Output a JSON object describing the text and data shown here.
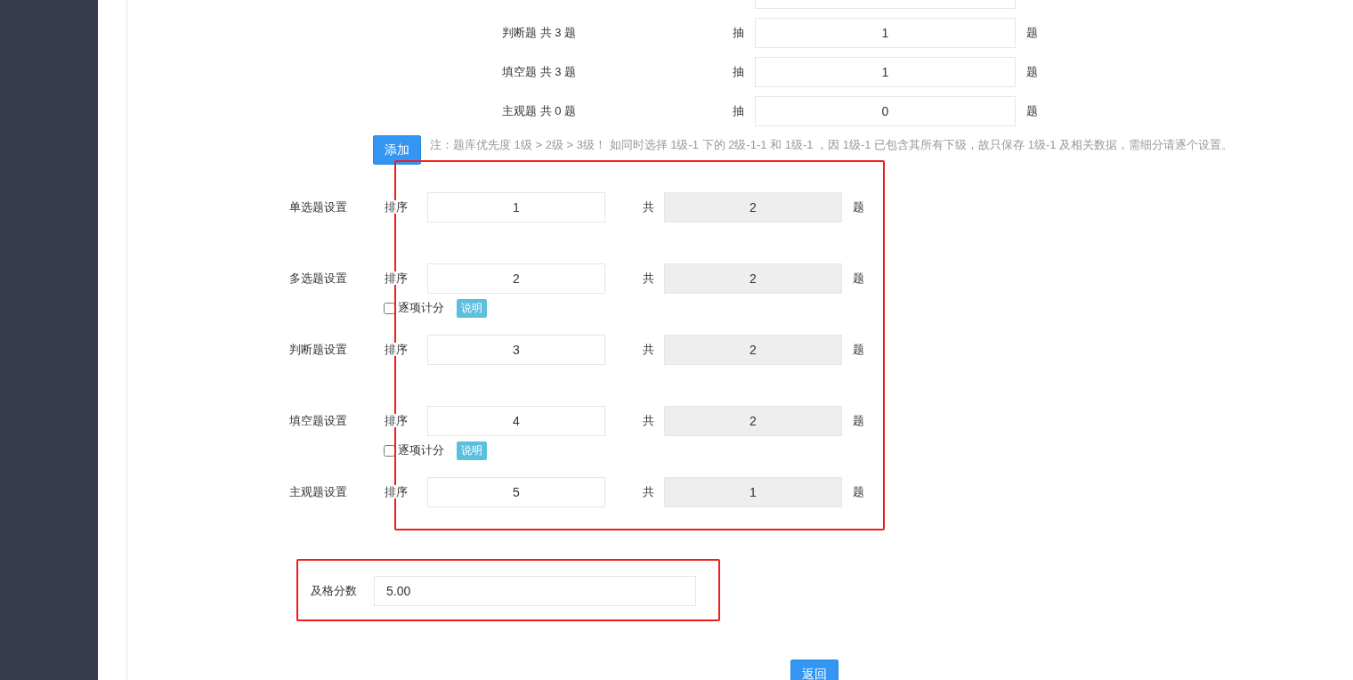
{
  "draw_rows": [
    {
      "label": "判断题 共 3 题",
      "prefix": "抽",
      "value": "1",
      "suffix": "题"
    },
    {
      "label": "填空题 共 3 题",
      "prefix": "抽",
      "value": "1",
      "suffix": "题"
    },
    {
      "label": "主观题 共 0 题",
      "prefix": "抽",
      "value": "0",
      "suffix": "题"
    }
  ],
  "add_button": "添加",
  "note": "注：题库优先度 1级 > 2级 > 3级！ 如同时选择 1级-1 下的 2级-1-1 和 1级-1 ，因 1级-1 已包含其所有下级，故只保存 1级-1 及相关数据，需细分请逐个设置。",
  "settings": [
    {
      "label": "单选题设置",
      "order_label": "排序",
      "order": "1",
      "total_label": "共",
      "total": "2",
      "total_disabled": true,
      "suffix": "题"
    },
    {
      "label": "多选题设置",
      "order_label": "排序",
      "order": "2",
      "total_label": "共",
      "total": "2",
      "total_disabled": true,
      "suffix": "题",
      "option": {
        "label": "逐项计分",
        "checked": false,
        "help": "说明"
      }
    },
    {
      "label": "判断题设置",
      "order_label": "排序",
      "order": "3",
      "total_label": "共",
      "total": "2",
      "total_disabled": true,
      "suffix": "题"
    },
    {
      "label": "填空题设置",
      "order_label": "排序",
      "order": "4",
      "total_label": "共",
      "total": "2",
      "total_disabled": true,
      "suffix": "题",
      "option": {
        "label": "逐项计分",
        "checked": false,
        "help": "说明"
      }
    },
    {
      "label": "主观题设置",
      "order_label": "排序",
      "order": "5",
      "total_label": "共",
      "total": "1",
      "total_disabled": true,
      "suffix": "题"
    }
  ],
  "pass_score": {
    "label": "及格分数",
    "value": "5.00"
  },
  "back_button": "返回"
}
